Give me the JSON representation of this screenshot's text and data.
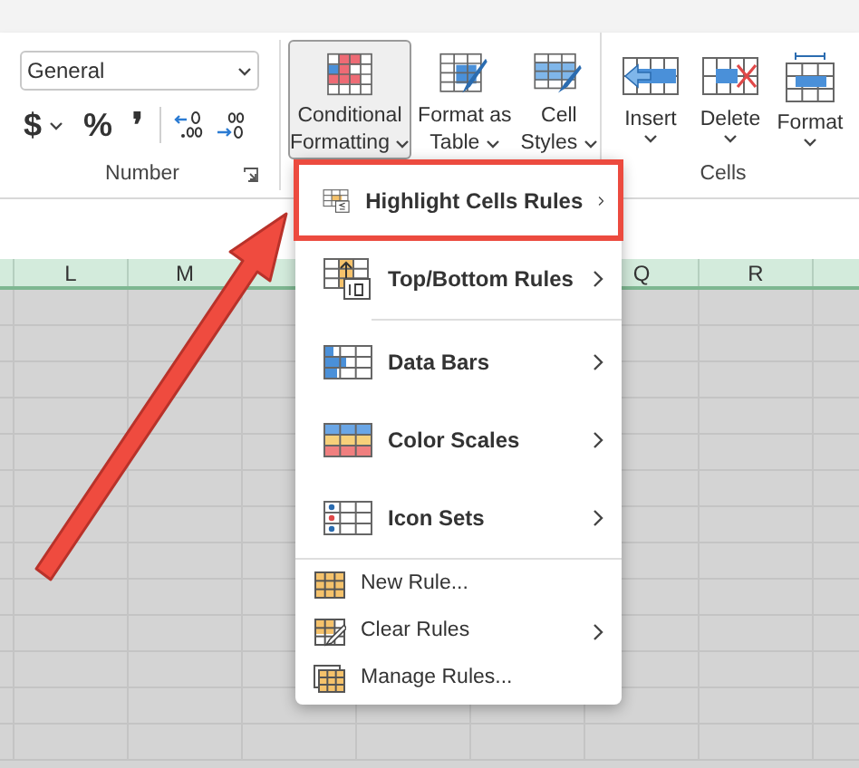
{
  "ribbon": {
    "number_group": {
      "label": "Number",
      "format_dropdown": "General",
      "symbols": [
        {
          "label": "$",
          "has_menu": true
        },
        {
          "label": "%",
          "has_menu": false
        },
        {
          "label": "❜",
          "has_menu": false
        }
      ]
    },
    "styles_buttons": [
      {
        "lines": [
          "Conditional",
          "Formatting"
        ],
        "has_menu": true,
        "expanded": true
      },
      {
        "lines": [
          "Format as",
          "Table"
        ],
        "has_menu": true,
        "expanded": false
      },
      {
        "lines": [
          "Cell",
          "Styles"
        ],
        "has_menu": true,
        "expanded": false
      }
    ],
    "cells_group": {
      "label": "Cells",
      "buttons": [
        {
          "lines": [
            "Insert"
          ],
          "has_menu": true
        },
        {
          "lines": [
            "Delete"
          ],
          "has_menu": true
        },
        {
          "lines": [
            "Format"
          ],
          "has_menu": true
        }
      ]
    }
  },
  "column_headers": {
    "left": [
      "L",
      "M"
    ],
    "right": [
      "Q",
      "R"
    ]
  },
  "menu": {
    "items": [
      {
        "kind": "large",
        "label": "Highlight Cells Rules",
        "submenu": true,
        "annotated": true
      },
      {
        "kind": "large",
        "label": "Top/Bottom Rules",
        "submenu": true,
        "annotated": false
      },
      {
        "kind": "separator"
      },
      {
        "kind": "large",
        "label": "Data Bars",
        "submenu": true,
        "annotated": false
      },
      {
        "kind": "large",
        "label": "Color Scales",
        "submenu": true,
        "annotated": false
      },
      {
        "kind": "large",
        "label": "Icon Sets",
        "submenu": true,
        "annotated": false
      },
      {
        "kind": "separator"
      },
      {
        "kind": "small",
        "label": "New Rule...",
        "submenu": false,
        "annotated": false
      },
      {
        "kind": "small",
        "label": "Clear Rules",
        "submenu": true,
        "annotated": false
      },
      {
        "kind": "small",
        "label": "Manage Rules...",
        "submenu": false,
        "annotated": false
      }
    ]
  }
}
